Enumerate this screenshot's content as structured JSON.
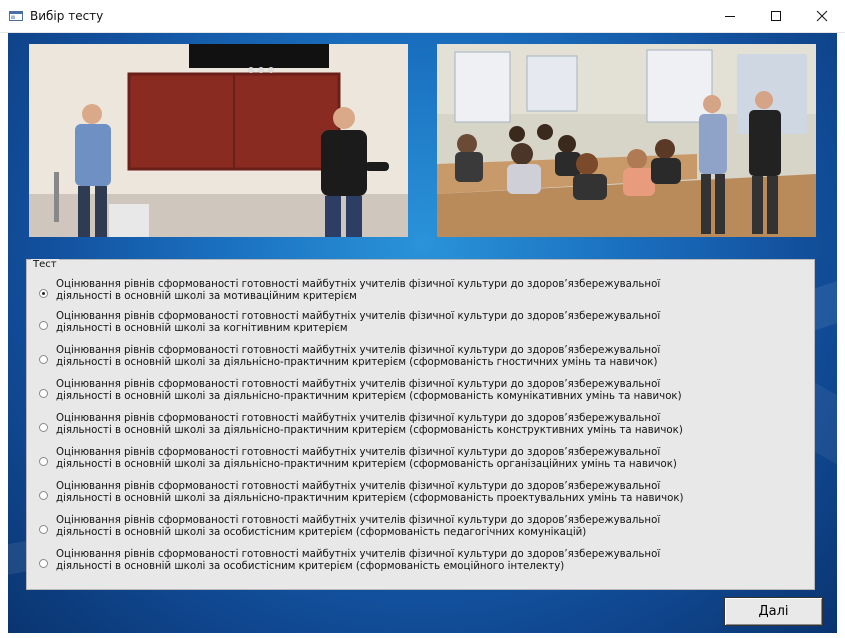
{
  "window": {
    "title": "Вибір тесту"
  },
  "group": {
    "title": "Тест",
    "selected_index": 0,
    "options": [
      {
        "line1": "Оцінювання рівнів сформованості готовності майбутніх учителів фізичної культури до здоров’язбережувальної",
        "line2": "діяльності в  основній школі за мотиваційним критерієм"
      },
      {
        "line1": "Оцінювання рівнів сформованості готовності майбутніх учителів фізичної культури до здоров’язбережувальної",
        "line2": "діяльності в  основній школі за когнітивним критерієм"
      },
      {
        "line1": "Оцінювання рівнів сформованості готовності майбутніх учителів фізичної культури до здоров’язбережувальної",
        "line2": "діяльності в  основній школі за діяльнісно-практичним критерієм (сформованість гностичних умінь та навичок)"
      },
      {
        "line1": "Оцінювання рівнів сформованості готовності майбутніх учителів фізичної культури до здоров’язбережувальної",
        "line2": "діяльності в  основній школі за діяльнісно-практичним критерієм (сформованість комунікативних умінь та навичок)"
      },
      {
        "line1": "Оцінювання рівнів сформованості готовності майбутніх учителів фізичної культури до здоров’язбережувальної",
        "line2": "діяльності в  основній школі за діяльнісно-практичним критерієм (сформованість конструктивних умінь та навичок)"
      },
      {
        "line1": "Оцінювання рівнів сформованості готовності майбутніх учителів фізичної культури до здоров’язбережувальної",
        "line2": "діяльності в  основній школі за діяльнісно-практичним критерієм (сформованість організаційних умінь та навичок)"
      },
      {
        "line1": "Оцінювання рівнів сформованості готовності майбутніх учителів фізичної культури до здоров’язбережувальної",
        "line2": "діяльності в  основній школі за діяльнісно-практичним критерієм (сформованість проектувальних умінь та навичок)"
      },
      {
        "line1": "Оцінювання рівнів сформованості готовності майбутніх учителів фізичної культури до здоров’язбережувальної",
        "line2": "діяльності в  основній школі за особистісним критерієм (сформованість педагогічних комунікацій)"
      },
      {
        "line1": "Оцінювання рівнів сформованості готовності майбутніх учителів фізичної культури до здоров’язбережувальної",
        "line2": "діяльності в  основній школі за особистісним критерієм (сформованість емоційного інтелекту)"
      }
    ]
  },
  "buttons": {
    "next": "Далі"
  },
  "icons": {
    "minimize": "minimize-icon",
    "maximize": "maximize-icon",
    "close": "close-icon",
    "app": "app-window-icon"
  },
  "colors": {
    "background_accent": "#1a6fbf",
    "panel": "#e8e8e8"
  }
}
